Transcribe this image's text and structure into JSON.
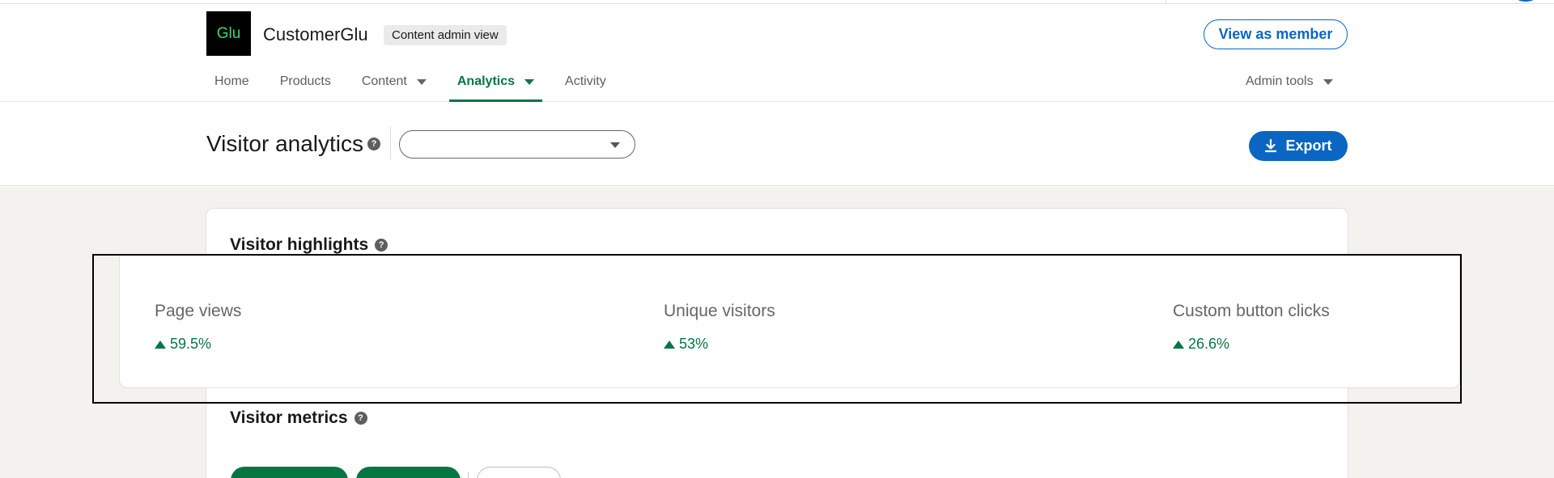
{
  "header": {
    "logo_text": "Glu",
    "org_name": "CustomerGlu",
    "admin_badge": "Content admin view",
    "view_as_member": "View as member"
  },
  "nav": {
    "items": [
      {
        "label": "Home",
        "has_dropdown": false,
        "active": false
      },
      {
        "label": "Products",
        "has_dropdown": false,
        "active": false
      },
      {
        "label": "Content",
        "has_dropdown": true,
        "active": false
      },
      {
        "label": "Analytics",
        "has_dropdown": true,
        "active": true
      },
      {
        "label": "Activity",
        "has_dropdown": false,
        "active": false
      }
    ],
    "admin_tools": "Admin tools"
  },
  "page": {
    "title": "Visitor analytics",
    "select_value": "",
    "export_label": "Export"
  },
  "highlights": {
    "title": "Visitor highlights",
    "metrics": [
      {
        "label": "Page views",
        "change": "59.5%",
        "direction": "up"
      },
      {
        "label": "Unique visitors",
        "change": "53%",
        "direction": "up"
      },
      {
        "label": "Custom button clicks",
        "change": "26.6%",
        "direction": "up"
      }
    ]
  },
  "visitor_metrics": {
    "title": "Visitor metrics"
  },
  "colors": {
    "primary_blue": "#0a66c2",
    "success_green": "#057642",
    "background": "#f3f2ef",
    "logo_text": "#3bd67a"
  },
  "icons": {
    "help": "question-circle-icon",
    "export": "download-icon",
    "dropdown": "caret-down-icon",
    "trend_up": "triangle-up-icon"
  }
}
